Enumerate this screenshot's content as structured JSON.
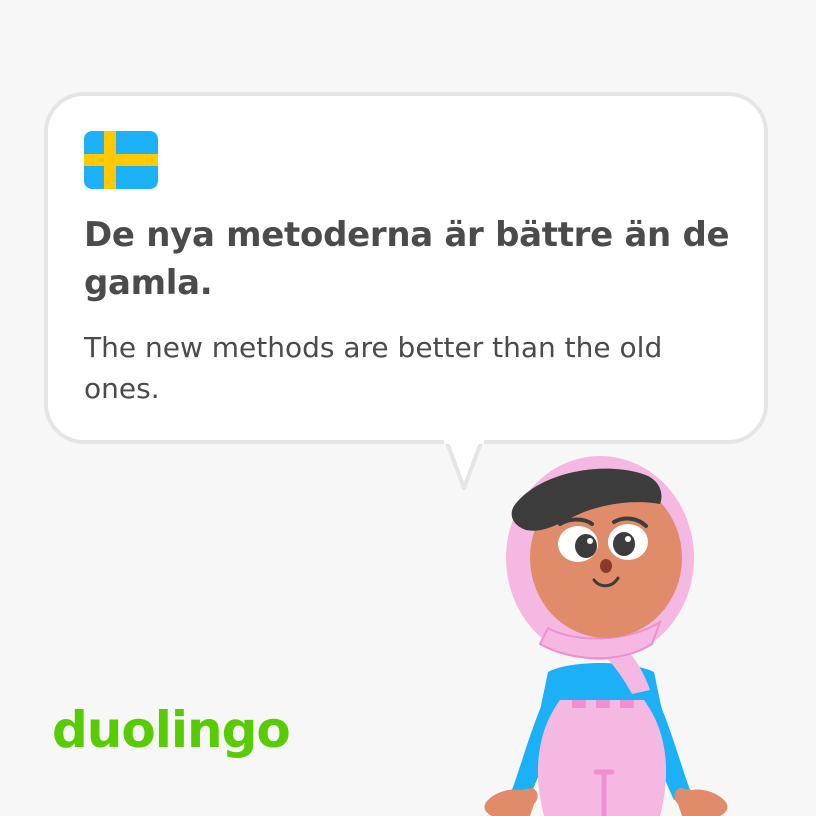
{
  "card": {
    "flag_icon": "sweden-flag-icon",
    "sentence": "De nya metoderna är bättre än de gamla.",
    "translation": "The new methods are better than the old ones."
  },
  "brand": {
    "logo_text": "duolingo",
    "logo_color": "#58cc02"
  },
  "character": {
    "icon": "lily-character-illustration"
  },
  "colors": {
    "background": "#f7f7f7",
    "bubble": "#ffffff",
    "bubble_border": "#e5e5e5",
    "text": "#4b4b4b",
    "flag_blue": "#1cb0f6",
    "flag_yellow": "#ffc800"
  }
}
